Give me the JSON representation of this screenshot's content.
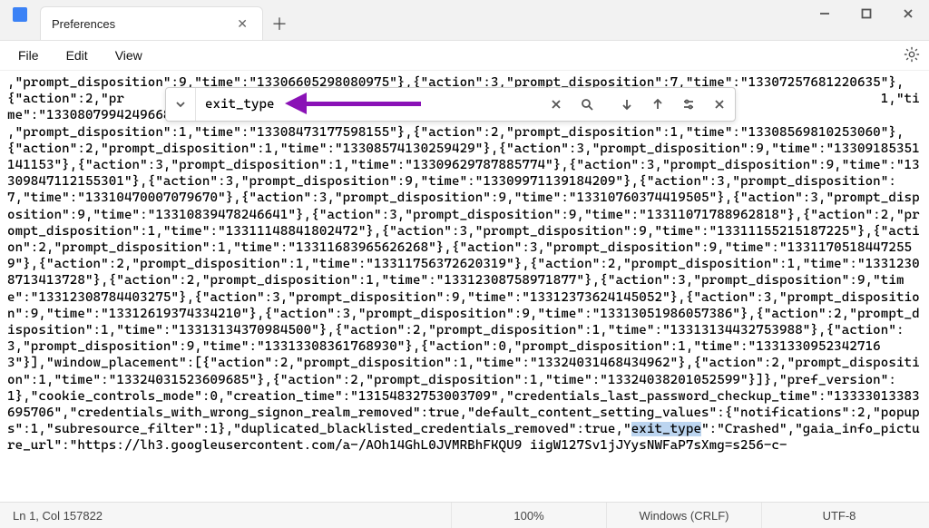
{
  "title": {
    "tab_label": "Preferences"
  },
  "menus": {
    "file": "File",
    "edit": "Edit",
    "view": "View"
  },
  "find": {
    "value": "exit_type",
    "placeholder": ""
  },
  "status": {
    "cursor": "Ln 1, Col 157822",
    "zoom": "100%",
    "lineending": "Windows (CRLF)",
    "encoding": "UTF-8"
  },
  "body_pre": ",\"prompt_disposition\":9,\"time\":\"13306605298080975\"},{\"action\":3,\"prompt_disposition\":7,\"time\":\"13307257681220635\"},{\"action\":2,\"pr                                                                                                 1,\"time\":\"13308079942496683\"},{                                                                                                 ,\"prompt_disposition\":1,\"time\":\"13308473177598155\"},{\"action\":2,\"prompt_disposition\":1,\"time\":\"13308569810253060\"},{\"action\":2,\"prompt_disposition\":1,\"time\":\"13308574130259429\"},{\"action\":3,\"prompt_disposition\":9,\"time\":\"13309185351141153\"},{\"action\":3,\"prompt_disposition\":1,\"time\":\"13309629787885774\"},{\"action\":3,\"prompt_disposition\":9,\"time\":\"13309847112155301\"},{\"action\":3,\"prompt_disposition\":9,\"time\":\"13309971139184209\"},{\"action\":3,\"prompt_disposition\":7,\"time\":\"13310470007079670\"},{\"action\":3,\"prompt_disposition\":9,\"time\":\"13310760374419505\"},{\"action\":3,\"prompt_disposition\":9,\"time\":\"13310839478246641\"},{\"action\":3,\"prompt_disposition\":9,\"time\":\"13311071788962818\"},{\"action\":2,\"prompt_disposition\":1,\"time\":\"13311148841802472\"},{\"action\":3,\"prompt_disposition\":9,\"time\":\"13311155215187225\"},{\"action\":2,\"prompt_disposition\":1,\"time\":\"13311683965626268\"},{\"action\":3,\"prompt_disposition\":9,\"time\":\"13311705184472559\"},{\"action\":2,\"prompt_disposition\":1,\"time\":\"13311756372620319\"},{\"action\":2,\"prompt_disposition\":1,\"time\":\"13312308713413728\"},{\"action\":2,\"prompt_disposition\":1,\"time\":\"13312308758971877\"},{\"action\":3,\"prompt_disposition\":9,\"time\":\"13312308784403275\"},{\"action\":3,\"prompt_disposition\":9,\"time\":\"13312373624145052\"},{\"action\":3,\"prompt_disposition\":9,\"time\":\"13312619374334210\"},{\"action\":3,\"prompt_disposition\":9,\"time\":\"13313051986057386\"},{\"action\":2,\"prompt_disposition\":1,\"time\":\"13313134370984500\"},{\"action\":2,\"prompt_disposition\":1,\"time\":\"13313134432753988\"},{\"action\":3,\"prompt_disposition\":9,\"time\":\"13313308361768930\"},{\"action\":0,\"prompt_disposition\":1,\"time\":\"13313309523427163\"}],\"window_placement\":[{\"action\":2,\"prompt_disposition\":1,\"time\":\"13324031468434962\"},{\"action\":2,\"prompt_disposition\":1,\"time\":\"13324031523609685\"},{\"action\":2,\"prompt_disposition\":1,\"time\":\"13324038201052599\"}]},\"pref_version\":1},\"cookie_controls_mode\":0,\"creation_time\":\"13154832753003709\",\"credentials_last_password_checkup_time\":\"13333013383695706\",\"credentials_with_wrong_signon_realm_removed\":true,\"default_content_setting_values\":{\"notifications\":2,\"popups\":1,\"subresource_filter\":1},\"duplicated_blacklisted_credentials_removed\":true,\"",
  "body_highlight": "exit_type",
  "body_post": "\":\"Crashed\",\"gaia_info_picture_url\":\"https://lh3.googleusercontent.com/a-/AOh14GhL0JVMRBhFKQU9 iigW127Sv1jJYysNWFaP7sXmg=s256-c-"
}
